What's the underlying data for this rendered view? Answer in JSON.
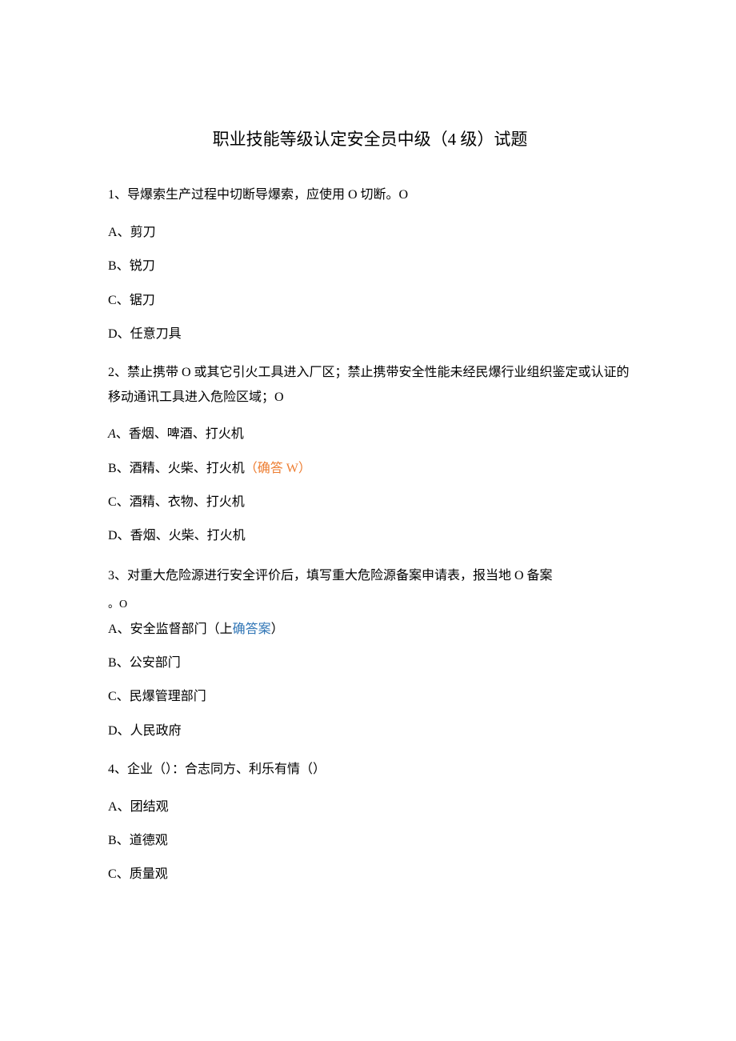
{
  "title": "职业技能等级认定安全员中级（4 级）试题",
  "q1": {
    "text": "1、导爆索生产过程中切断导爆索，应使用 O 切断。O",
    "optA_prefix": "A、",
    "optA": "剪刀",
    "optB_prefix": "B、",
    "optB": "锐刀",
    "optC_prefix": "C、",
    "optC": "锯刀",
    "optD_prefix": "D、",
    "optD": "任意刀具"
  },
  "q2": {
    "text": "2、禁止携带 O 或其它引火工具进入厂区；禁止携带安全性能未经民爆行业组织鉴定或认证的移动通讯工具进入危险区域；O",
    "optA_prefix": "A",
    "optA": "、香烟、啤酒、打火机",
    "optB_prefix": "B、",
    "optB_text": "酒精、火柴、打火机",
    "optB_answer_open": "（",
    "optB_answer_text": "确答 W",
    "optB_answer_close": "）",
    "optC_prefix": "C、",
    "optC": "酒精、衣物、打火机",
    "optD_prefix": "D、",
    "optD": "香烟、火柴、打火机"
  },
  "q3": {
    "text_line1": "3、对重大危险源进行安全评价后，填写重大危险源备案申请表，报当地 O 备案",
    "text_line_o": "。O",
    "optA_prefix": "A、",
    "optA_text": "安全监督部门（上",
    "optA_answer": "确答案",
    "optA_close": "）",
    "optB_prefix": "B、",
    "optB": "公安部门",
    "optC_prefix": "C、",
    "optC": "民爆管理部门",
    "optD_prefix": "D、",
    "optD": "人民政府"
  },
  "q4": {
    "text": "4、企业（）：合志同方、利乐有情（）",
    "optA_prefix": "A、",
    "optA": "团结观",
    "optB_prefix": "B、",
    "optB": "道德观",
    "optC_prefix": "C、",
    "optC": "质量观"
  }
}
